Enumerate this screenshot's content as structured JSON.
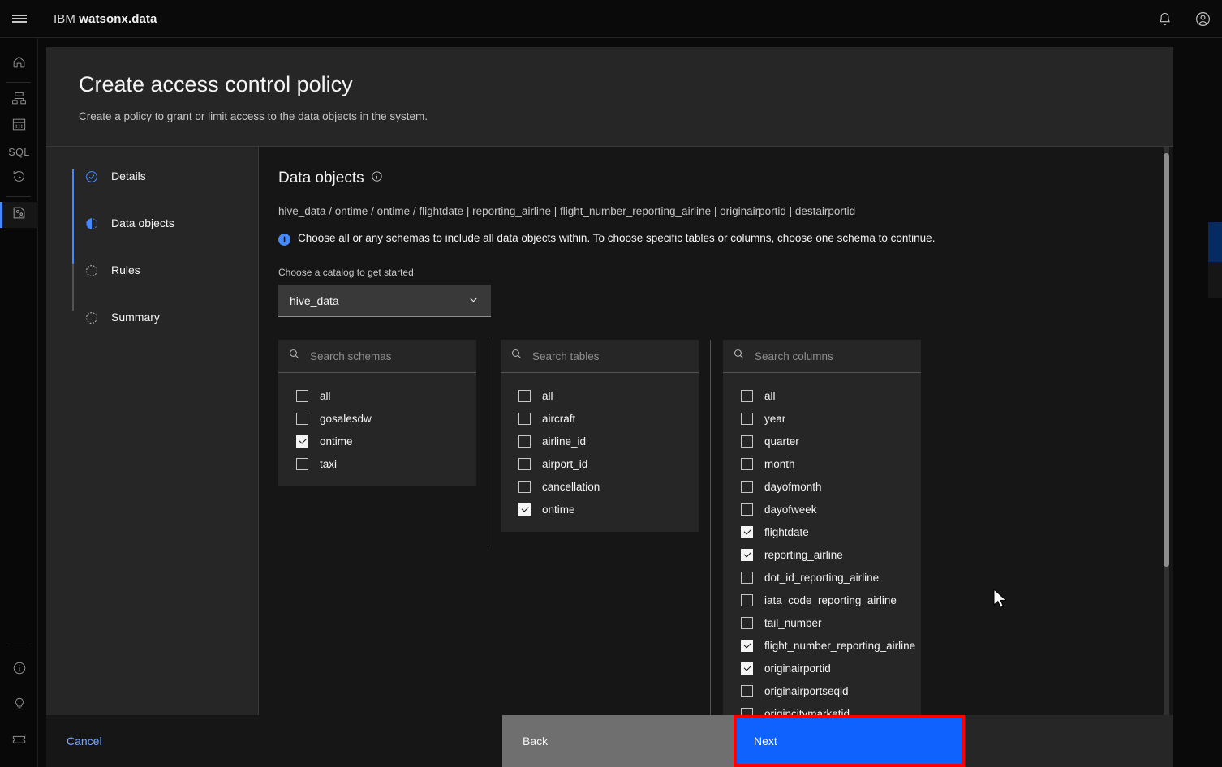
{
  "app": {
    "brand_prefix": "IBM",
    "brand_name": "watsonx.data",
    "menu_icon": "hamburger-icon",
    "notifications_icon": "bell-icon",
    "account_icon": "user-avatar-icon"
  },
  "rail": {
    "top_items": [
      {
        "name": "home",
        "icon": "home-icon"
      },
      {
        "name": "infrastructure",
        "icon": "infrastructure-icon"
      },
      {
        "name": "data-manager",
        "icon": "data-manager-icon"
      },
      {
        "name": "sql",
        "icon": "sql-icon"
      },
      {
        "name": "query-history",
        "icon": "history-icon"
      },
      {
        "name": "access-control",
        "icon": "access-control-icon",
        "active": true
      }
    ],
    "bottom_items": [
      {
        "name": "about",
        "icon": "info-circle-icon"
      },
      {
        "name": "tips",
        "icon": "lightbulb-icon"
      },
      {
        "name": "support",
        "icon": "ticket-icon"
      }
    ]
  },
  "background": {
    "add_button_label": "+"
  },
  "modal": {
    "title": "Create access control policy",
    "subtitle": "Create a policy to grant or limit access to the data objects in the system."
  },
  "steps": [
    {
      "label": "Details",
      "state": "done",
      "icon": "check-circle-icon"
    },
    {
      "label": "Data objects",
      "state": "current",
      "icon": "half-circle-icon"
    },
    {
      "label": "Rules",
      "state": "todo",
      "icon": "dotted-circle-icon"
    },
    {
      "label": "Summary",
      "state": "todo",
      "icon": "dotted-circle-icon"
    }
  ],
  "pane": {
    "title": "Data objects",
    "title_info_icon": "info-circle-icon",
    "breadcrumb": "hive_data / ontime / ontime / flightdate | reporting_airline | flight_number_reporting_airline | originairportid | destairportid",
    "notice": "Choose all or any schemas to include all data objects within. To choose specific tables or columns, choose one schema to continue.",
    "catalog_label": "Choose a catalog to get started",
    "catalog_value": "hive_data",
    "catalog_chevron_icon": "chevron-down-icon"
  },
  "pickers": [
    {
      "name": "schemas",
      "search_placeholder": "Search schemas",
      "search_icon": "search-icon",
      "options": [
        {
          "label": "all",
          "checked": false
        },
        {
          "label": "gosalesdw",
          "checked": false
        },
        {
          "label": "ontime",
          "checked": true
        },
        {
          "label": "taxi",
          "checked": false
        }
      ]
    },
    {
      "name": "tables",
      "search_placeholder": "Search tables",
      "search_icon": "search-icon",
      "options": [
        {
          "label": "all",
          "checked": false
        },
        {
          "label": "aircraft",
          "checked": false
        },
        {
          "label": "airline_id",
          "checked": false
        },
        {
          "label": "airport_id",
          "checked": false
        },
        {
          "label": "cancellation",
          "checked": false
        },
        {
          "label": "ontime",
          "checked": true
        }
      ]
    },
    {
      "name": "columns",
      "search_placeholder": "Search columns",
      "search_icon": "search-icon",
      "options": [
        {
          "label": "all",
          "checked": false
        },
        {
          "label": "year",
          "checked": false
        },
        {
          "label": "quarter",
          "checked": false
        },
        {
          "label": "month",
          "checked": false
        },
        {
          "label": "dayofmonth",
          "checked": false
        },
        {
          "label": "dayofweek",
          "checked": false
        },
        {
          "label": "flightdate",
          "checked": true
        },
        {
          "label": "reporting_airline",
          "checked": true
        },
        {
          "label": "dot_id_reporting_airline",
          "checked": false
        },
        {
          "label": "iata_code_reporting_airline",
          "checked": false
        },
        {
          "label": "tail_number",
          "checked": false
        },
        {
          "label": "flight_number_reporting_airline",
          "checked": true
        },
        {
          "label": "originairportid",
          "checked": true
        },
        {
          "label": "originairportseqid",
          "checked": false
        },
        {
          "label": "origincitymarketid",
          "checked": false
        }
      ]
    }
  ],
  "footer": {
    "cancel_label": "Cancel",
    "back_label": "Back",
    "next_label": "Next"
  },
  "colors": {
    "accent_blue": "#0f62fe",
    "link_blue": "#78a9ff",
    "highlight_red": "#ff0000",
    "modal_bg": "#262626",
    "pane_bg": "#161616"
  }
}
